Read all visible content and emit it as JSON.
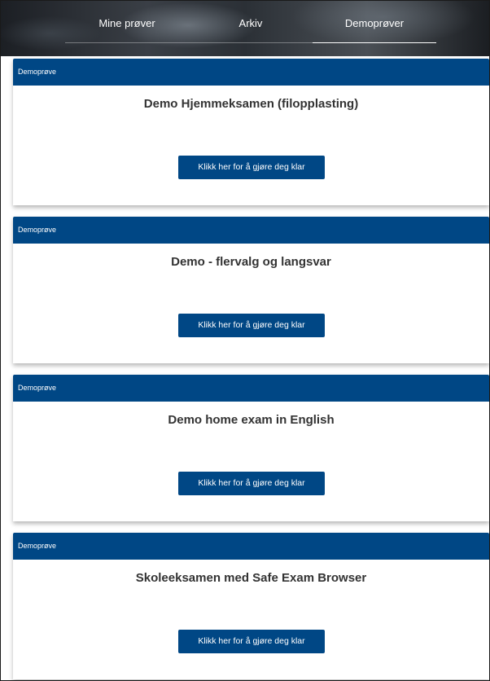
{
  "nav": {
    "tabs": [
      {
        "label": "Mine prøver",
        "active": false
      },
      {
        "label": "Arkiv",
        "active": false
      },
      {
        "label": "Demoprøver",
        "active": true
      }
    ]
  },
  "cards": [
    {
      "badge": "Demoprøve",
      "title": "Demo Hjemmeksamen (filopplasting)",
      "button_label": "Klikk her for å gjøre deg klar"
    },
    {
      "badge": "Demoprøve",
      "title": "Demo - flervalg og langsvar",
      "button_label": "Klikk her for å gjøre deg klar"
    },
    {
      "badge": "Demoprøve",
      "title": "Demo home exam in English",
      "button_label": "Klikk her for å gjøre deg klar"
    },
    {
      "badge": "Demoprøve",
      "title": "Skoleeksamen med Safe Exam Browser",
      "button_label": "Klikk her for å gjøre deg klar"
    }
  ],
  "colors": {
    "primary": "#004785",
    "title_text": "#333333"
  }
}
